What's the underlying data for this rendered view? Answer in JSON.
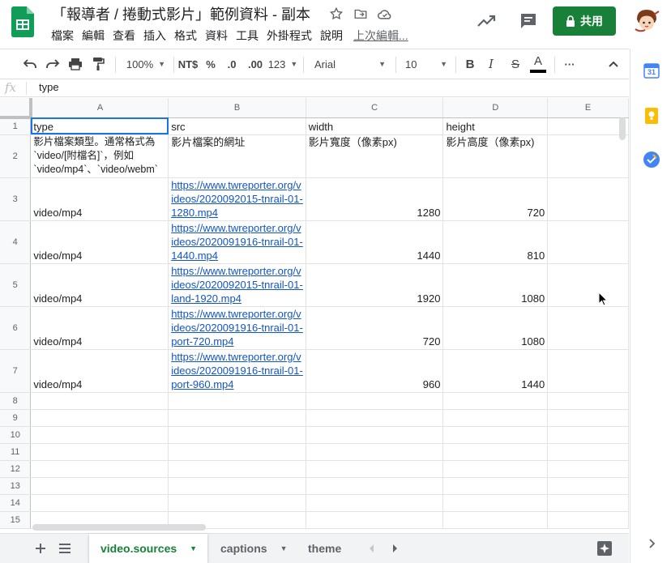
{
  "header": {
    "title": "「報導者 / 捲動式影片」範例資料 - 副本",
    "menu": [
      "檔案",
      "編輯",
      "查看",
      "插入",
      "格式",
      "資料",
      "工具",
      "外掛程式",
      "說明"
    ],
    "last_edit": "上次編輯...",
    "share_label": "共用"
  },
  "toolbar": {
    "zoom": "100%",
    "currency": "NT$",
    "percent": "%",
    "decrease_decimal": ".0",
    "increase_decimal": ".00",
    "more_formats": "123",
    "font": "Arial",
    "font_size": "10",
    "bold": "B",
    "italic": "I",
    "strike": "S",
    "text_color": "A",
    "more": "···"
  },
  "formula_bar": {
    "fx": "fx",
    "value": "type"
  },
  "grid": {
    "columns": [
      "A",
      "B",
      "C",
      "D",
      "E"
    ],
    "row_numbers": [
      "1",
      "2",
      "3",
      "4",
      "5",
      "6",
      "7",
      "8",
      "9",
      "10",
      "11",
      "12",
      "13",
      "14",
      "15"
    ],
    "header_row": [
      "type",
      "src",
      "width",
      "height"
    ],
    "description_row": [
      "影片檔案類型。通常格式為 `video/[附檔名]`，例如 `video/mp4`、`video/webm`",
      "影片檔案的網址",
      "影片寬度（像素px)",
      "影片高度（像素px)"
    ],
    "rows": [
      {
        "type": "video/mp4",
        "src": "https://www.twreporter.org/videos/2020092015-tnrail-01-1280.mp4",
        "width": "1280",
        "height": "720"
      },
      {
        "type": "video/mp4",
        "src": "https://www.twreporter.org/videos/2020091916-tnrail-01-1440.mp4",
        "width": "1440",
        "height": "810"
      },
      {
        "type": "video/mp4",
        "src": "https://www.twreporter.org/videos/2020092015-tnrail-01-land-1920.mp4",
        "width": "1920",
        "height": "1080"
      },
      {
        "type": "video/mp4",
        "src": "https://www.twreporter.org/videos/2020091916-tnrail-01-port-720.mp4",
        "width": "720",
        "height": "1080"
      },
      {
        "type": "video/mp4",
        "src": "https://www.twreporter.org/videos/2020091916-tnrail-01-port-960.mp4",
        "width": "960",
        "height": "1440"
      }
    ]
  },
  "sheets": {
    "tabs": [
      "video.sources",
      "captions",
      "theme"
    ],
    "active": "video.sources"
  },
  "colors": {
    "brand_green": "#188038",
    "link": "#1155cc",
    "selection": "#1a73e8"
  },
  "side_panel": {
    "calendar_day": "31"
  }
}
